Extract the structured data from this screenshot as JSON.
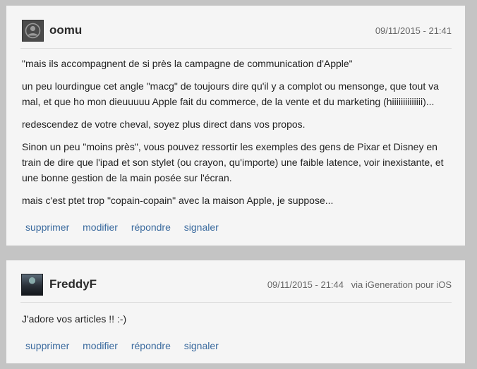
{
  "comments": [
    {
      "username": "oomu",
      "avatar_icon": "default-user-avatar-icon",
      "timestamp": "09/11/2015 - 21:41",
      "via": "",
      "paragraphs": [
        "\"mais ils accompagnent de si près la campagne de communication d'Apple\"",
        "un peu lourdingue cet angle \"macg\" de toujours dire qu'il y a complot ou mensonge, que tout va mal, et que ho mon dieuuuuu Apple fait du commerce, de la vente et du marketing (hiiiiiiiiiiiiii)...",
        "redescendez de votre cheval, soyez plus direct dans vos propos.",
        "Sinon un peu \"moins près\", vous pouvez ressortir les exemples des gens de Pixar et Disney en train de dire que l'ipad et son stylet (ou crayon, qu'importe) une faible latence, voir inexistante, et une bonne gestion de la main posée sur l'écran.",
        "mais c'est ptet trop \"copain-copain\" avec la maison Apple, je suppose..."
      ],
      "actions": {
        "delete": "supprimer",
        "edit": "modifier",
        "reply": "répondre",
        "report": "signaler"
      }
    },
    {
      "username": "FreddyF",
      "avatar_icon": "user-photo-avatar",
      "timestamp": "09/11/2015 - 21:44",
      "via": "via iGeneration pour iOS",
      "paragraphs": [
        "J'adore vos articles !! :-)"
      ],
      "actions": {
        "delete": "supprimer",
        "edit": "modifier",
        "reply": "répondre",
        "report": "signaler"
      }
    }
  ],
  "colors": {
    "page_background": "#c4c4c4",
    "card_background": "#f5f5f5",
    "link": "#3a6a9e"
  }
}
